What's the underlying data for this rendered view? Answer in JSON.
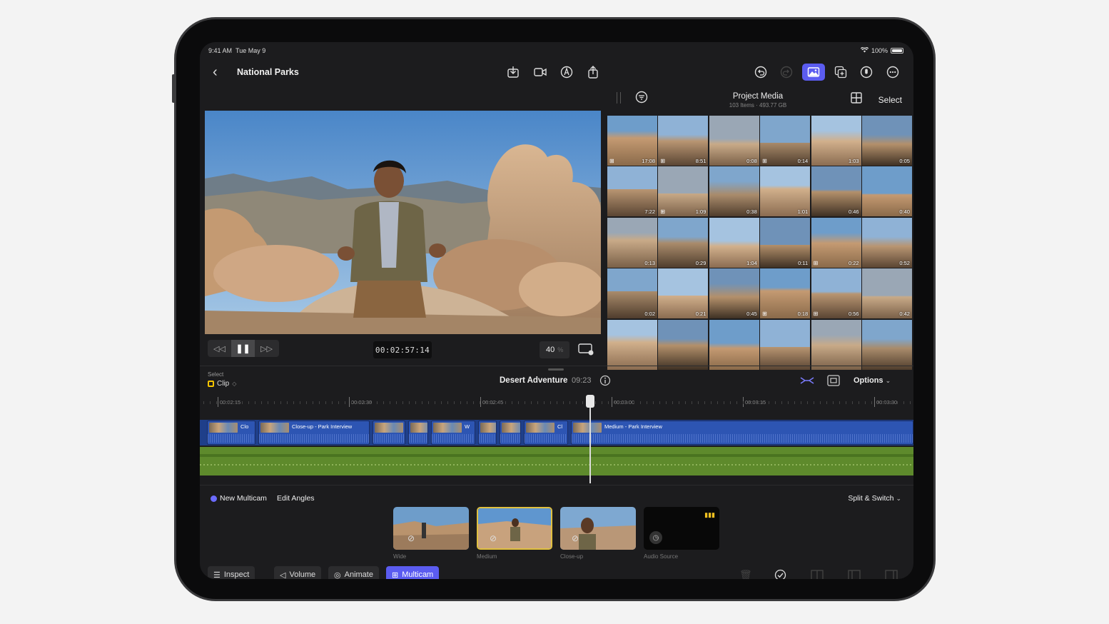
{
  "status": {
    "time": "9:41 AM",
    "date": "Tue May 9",
    "battery": "100%"
  },
  "toolbar": {
    "title": "National Parks",
    "icons": [
      "import-icon",
      "camera-icon",
      "pen-icon",
      "share-icon",
      "undo-icon",
      "redo-icon",
      "media-browser-icon",
      "photos-icon",
      "voiceover-icon",
      "more-icon"
    ]
  },
  "viewer": {
    "timecode": "00:02:57:14",
    "zoom": "40",
    "zoom_unit": "%"
  },
  "browser": {
    "title": "Project Media",
    "subtitle": "103 Items  ·  493.77 GB",
    "select": "Select",
    "durations": [
      "17:08",
      "8:51",
      "0:08",
      "0:14",
      "1:03",
      "0:05",
      "7:22",
      "1:09",
      "0:38",
      "1:01",
      "0:46",
      "0:40",
      "0:13",
      "0:29",
      "1:04",
      "0:11",
      "0:22",
      "0:52",
      "0:02",
      "0:21",
      "0:45",
      "0:18",
      "0:56",
      "0:42",
      "",
      "",
      "",
      "",
      "",
      ""
    ],
    "multicam_flags": [
      true,
      true,
      false,
      true,
      false,
      false,
      false,
      true,
      false,
      false,
      false,
      false,
      false,
      false,
      false,
      false,
      true,
      false,
      false,
      false,
      false,
      true,
      true,
      false,
      false,
      false,
      false,
      false,
      false,
      false
    ]
  },
  "timeline": {
    "select_label": "Select",
    "clip_label": "Clip",
    "project": "Desert Adventure",
    "duration": "09:23",
    "options": "Options",
    "ruler": [
      "00:02:15",
      "00:02:30",
      "00:02:45",
      "00:03:00",
      "00:03:15",
      "00:03:30"
    ],
    "clips": [
      {
        "label": "Clo"
      },
      {
        "label": "Close-up - Park Interview"
      },
      {
        "label": ""
      },
      {
        "label": ""
      },
      {
        "label": "W"
      },
      {
        "label": ""
      },
      {
        "label": ""
      },
      {
        "label": "Cl"
      },
      {
        "label": "Medium - Park Interview"
      }
    ]
  },
  "multicam": {
    "new": "New Multicam",
    "edit": "Edit Angles",
    "split": "Split & Switch",
    "angles": [
      "Wide",
      "Medium",
      "Close-up",
      "Audio Source"
    ]
  },
  "bottombar": {
    "inspect": "Inspect",
    "volume": "Volume",
    "animate": "Animate",
    "multicam": "Multicam"
  },
  "colors": {
    "accent": "#5b5cf0",
    "video_clip": "#2d55b3",
    "audio_track": "#5e8a2c",
    "selection": "#e0c040"
  }
}
